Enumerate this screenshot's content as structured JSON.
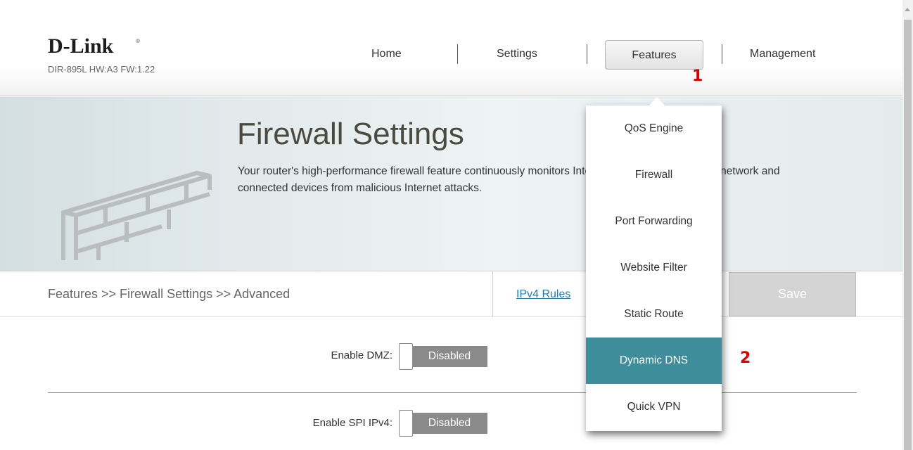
{
  "header": {
    "brand": "D-Link",
    "brand_mark": "®",
    "model_info": "DIR-895L HW:A3 FW:1.22",
    "nav": {
      "home": "Home",
      "settings": "Settings",
      "features": "Features",
      "management": "Management"
    }
  },
  "annotations": {
    "step1": "1",
    "step2": "2"
  },
  "banner": {
    "title": "Firewall Settings",
    "description": "Your router's high-performance firewall feature continuously monitors Internet traffic, protecting your network and connected devices from malicious Internet attacks."
  },
  "toolbar": {
    "breadcrumb": "Features >> Firewall Settings >> Advanced",
    "ipv4_rules": "IPv4 Rules",
    "save": "Save"
  },
  "form": {
    "dmz": {
      "label": "Enable DMZ:",
      "state": "Disabled"
    },
    "spi_ipv4": {
      "label": "Enable SPI IPv4:",
      "state": "Disabled"
    }
  },
  "features_menu": {
    "items": [
      "QoS Engine",
      "Firewall",
      "Port Forwarding",
      "Website Filter",
      "Static Route",
      "Dynamic DNS",
      "Quick VPN"
    ],
    "highlighted": "Dynamic DNS"
  },
  "colors": {
    "menu_highlight": "#3d8d9b",
    "annotation": "#d90000",
    "link": "#2a7aa8",
    "toggle_track": "#8a8a8a"
  }
}
